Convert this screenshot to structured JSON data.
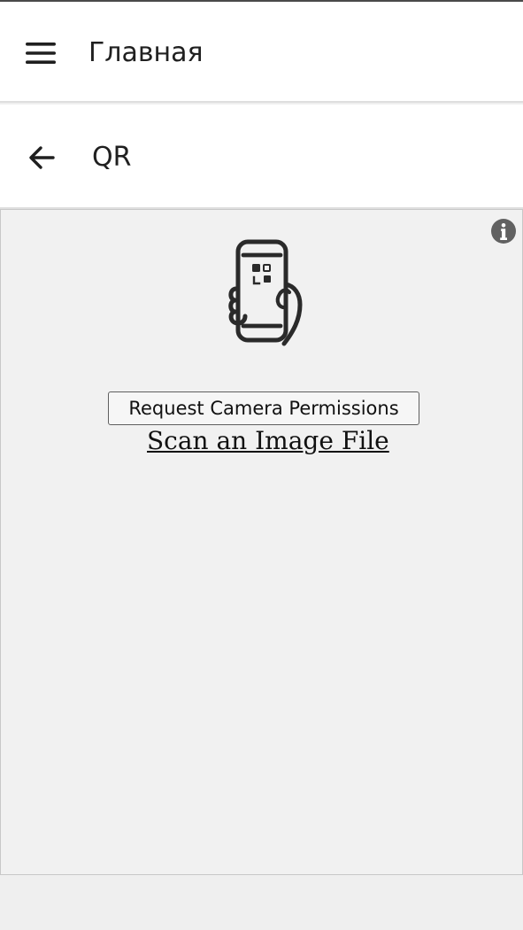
{
  "app": {
    "top_bar": {
      "menu_icon": "hamburger-menu-icon",
      "title": "Главная"
    },
    "second_bar": {
      "back_icon": "arrow-left-icon",
      "title": "QR"
    }
  },
  "scanner": {
    "info_icon": "info-icon",
    "illustration_icon": "phone-qr-scan-icon",
    "request_camera_label": "Request Camera Permissions",
    "scan_image_file_label": "Scan an Image File"
  },
  "colors": {
    "app_bar_background": "#ffffff",
    "scanner_background": "#f1f1f1",
    "page_background": "#efefef",
    "text": "#202020",
    "icon": "#1f1f1f",
    "info_icon": "#616161",
    "divider": "#dedede"
  }
}
